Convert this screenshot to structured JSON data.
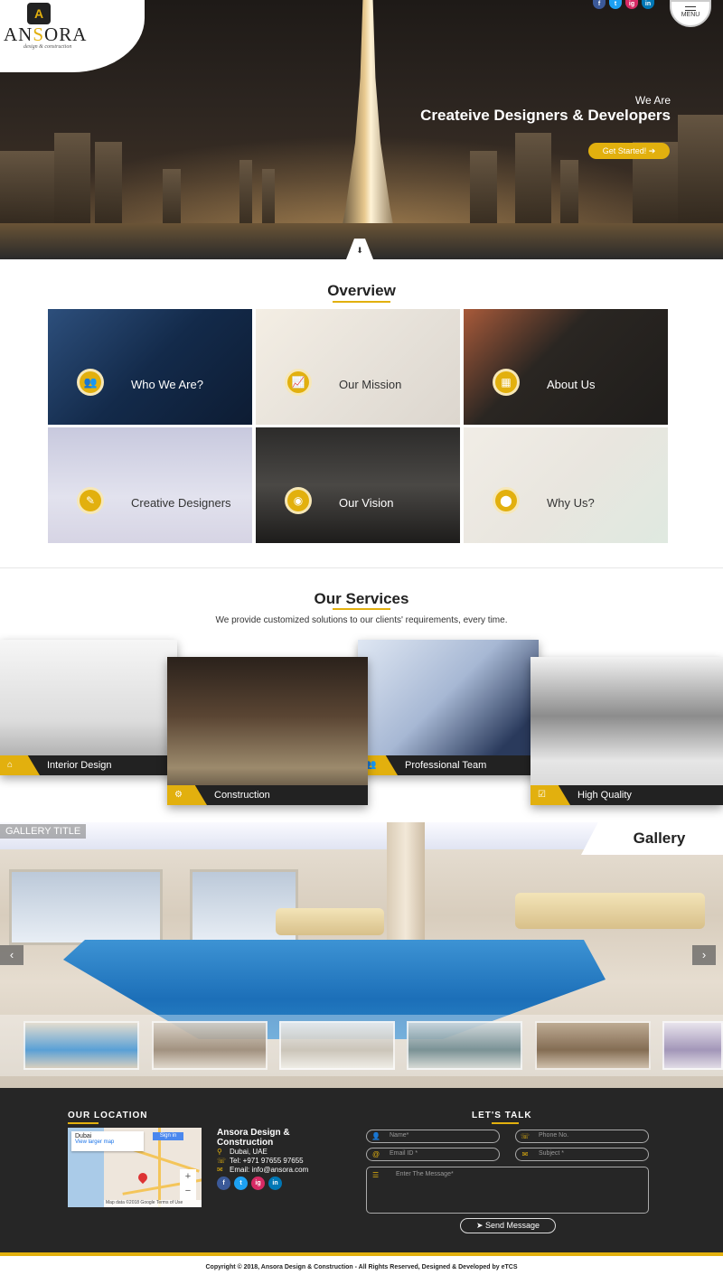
{
  "brand": {
    "logo_letter": "A",
    "name_pre": "AN",
    "name_mid": "S",
    "name_post": "ORA",
    "tagline": "design & construction"
  },
  "header": {
    "social": [
      "f",
      "t",
      "ig",
      "in"
    ],
    "menu_label": "MENU"
  },
  "hero": {
    "pre_title": "We Are",
    "title": "Createive Designers & Developers",
    "cta_label": "Get Started! ➔",
    "scroll_icon": "⬇"
  },
  "overview": {
    "title": "Overview",
    "tiles": [
      {
        "label": "Who We Are?",
        "icon": "users-icon",
        "glyph": "👥"
      },
      {
        "label": "Our Mission",
        "icon": "chart-icon",
        "glyph": "📈"
      },
      {
        "label": "About Us",
        "icon": "building-icon",
        "glyph": "▦"
      },
      {
        "label": "Creative Designers",
        "icon": "pencil-icon",
        "glyph": "✎"
      },
      {
        "label": "Our Vision",
        "icon": "eye-icon",
        "glyph": "◉"
      },
      {
        "label": "Why Us?",
        "icon": "coins-icon",
        "glyph": "⬤"
      }
    ]
  },
  "services": {
    "title": "Our Services",
    "subtitle": "We provide customized solutions to our clients' requirements, every time.",
    "items": [
      {
        "label": "Interior Design",
        "glyph": "⌂"
      },
      {
        "label": "Construction",
        "glyph": "⚙"
      },
      {
        "label": "Professional Team",
        "glyph": "👥"
      },
      {
        "label": "High Quality",
        "glyph": "☑"
      }
    ]
  },
  "gallery": {
    "title_tag": "GALLERY TITLE",
    "label": "Gallery",
    "prev": "‹",
    "next": "›"
  },
  "footer": {
    "location_heading": "OUR LOCATION",
    "talk_heading": "LET'S TALK",
    "map": {
      "place": "Dubai",
      "link": "View larger map",
      "signin": "Sign in",
      "footer_text": "Map data ©2018 Google   Terms of Use"
    },
    "company": "Ansora Design & Construction",
    "address": "Dubai, UAE",
    "phone": "Tel: +971 97655 97655",
    "email": "Email: info@ansora.com",
    "social": [
      "f",
      "t",
      "ig",
      "in"
    ],
    "form": {
      "name_ph": "Name*",
      "phone_ph": "Phone No.",
      "email_ph": "Email ID *",
      "subject_ph": "Subject *",
      "message_ph": "Enter The Message*",
      "send_label": "➤ Send Message"
    },
    "copyright": "Copyright © 2018, Ansora Design & Construction - All Rights Reserved, Designed & Developed by eTCS"
  },
  "colors": {
    "accent": "#e2b00e",
    "footer_bg": "#262626"
  }
}
